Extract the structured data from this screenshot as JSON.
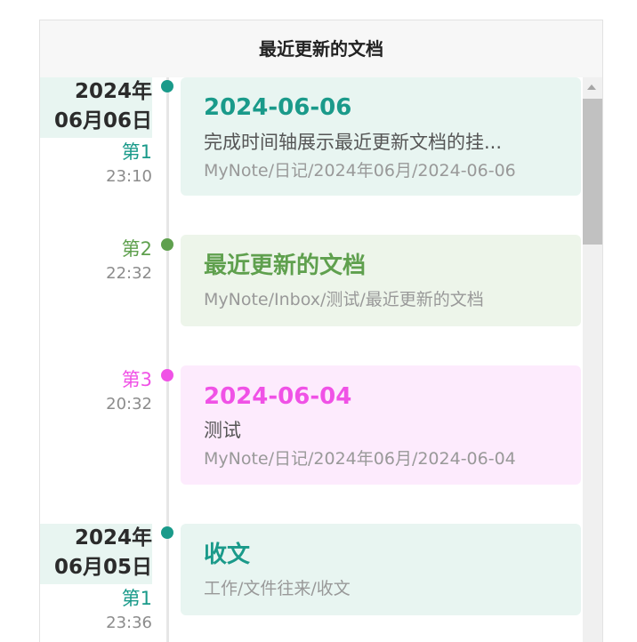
{
  "header": {
    "title": "最近更新的文档"
  },
  "timeline": {
    "entries": [
      {
        "date_line1": "2024年",
        "date_line2": "06月06日",
        "rank": "第1",
        "time": "23:10",
        "title": "2024-06-06",
        "description": "完成时间轴展示最近更新文档的挂...",
        "path": "MyNote/日记/2024年06月/2024-06-06",
        "accent_color": "#1a9a8a",
        "card_bg": "#e8f5f1"
      },
      {
        "date_line1": "",
        "date_line2": "",
        "rank": "第2",
        "time": "22:32",
        "title": "最近更新的文档",
        "description": "",
        "path": "MyNote/Inbox/测试/最近更新的文档",
        "accent_color": "#5fa04e",
        "card_bg": "#edf5ea"
      },
      {
        "date_line1": "",
        "date_line2": "",
        "rank": "第3",
        "time": "20:32",
        "title": "2024-06-04",
        "description": "测试",
        "path": "MyNote/日记/2024年06月/2024-06-04",
        "accent_color": "#f052e6",
        "card_bg": "#fdebfd"
      },
      {
        "date_line1": "2024年",
        "date_line2": "06月05日",
        "rank": "第1",
        "time": "23:36",
        "title": "收文",
        "description": "",
        "path": "工作/文件往来/收文",
        "accent_color": "#1a9a8a",
        "card_bg": "#e8f5f1"
      }
    ]
  },
  "colors": {
    "date_block_bg": "#e8f5f1",
    "timeline_line": "#e6e6e6"
  }
}
